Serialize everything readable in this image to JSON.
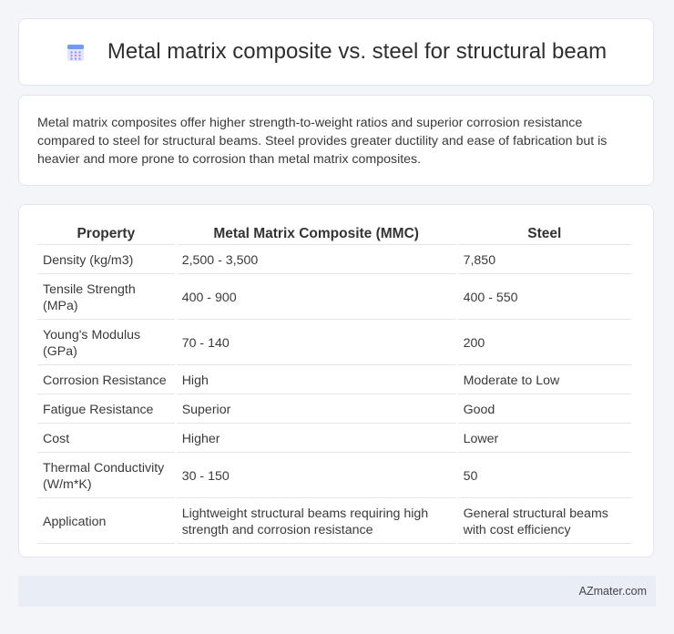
{
  "header": {
    "title": "Metal matrix composite vs. steel for structural beam",
    "icon": "building-icon"
  },
  "summary": {
    "text": "Metal matrix composites offer higher strength-to-weight ratios and superior corrosion resistance compared to steel for structural beams. Steel provides greater ductility and ease of fabrication but is heavier and more prone to corrosion than metal matrix composites."
  },
  "table": {
    "headers": [
      "Property",
      "Metal Matrix Composite (MMC)",
      "Steel"
    ],
    "rows": [
      [
        "Density (kg/m3)",
        "2,500 - 3,500",
        "7,850"
      ],
      [
        "Tensile Strength (MPa)",
        "400 - 900",
        "400 - 550"
      ],
      [
        "Young's Modulus (GPa)",
        "70 - 140",
        "200"
      ],
      [
        "Corrosion Resistance",
        "High",
        "Moderate to Low"
      ],
      [
        "Fatigue Resistance",
        "Superior",
        "Good"
      ],
      [
        "Cost",
        "Higher",
        "Lower"
      ],
      [
        "Thermal Conductivity (W/m*K)",
        "30 - 150",
        "50"
      ],
      [
        "Application",
        "Lightweight structural beams requiring high strength and corrosion resistance",
        "General structural beams with cost efficiency"
      ]
    ]
  },
  "footer": {
    "brand": "AZmater.com"
  },
  "colors": {
    "background": "#f3f5f9",
    "card": "#ffffff",
    "footer": "#e9edf5",
    "icon_accent": "#5b8def"
  }
}
